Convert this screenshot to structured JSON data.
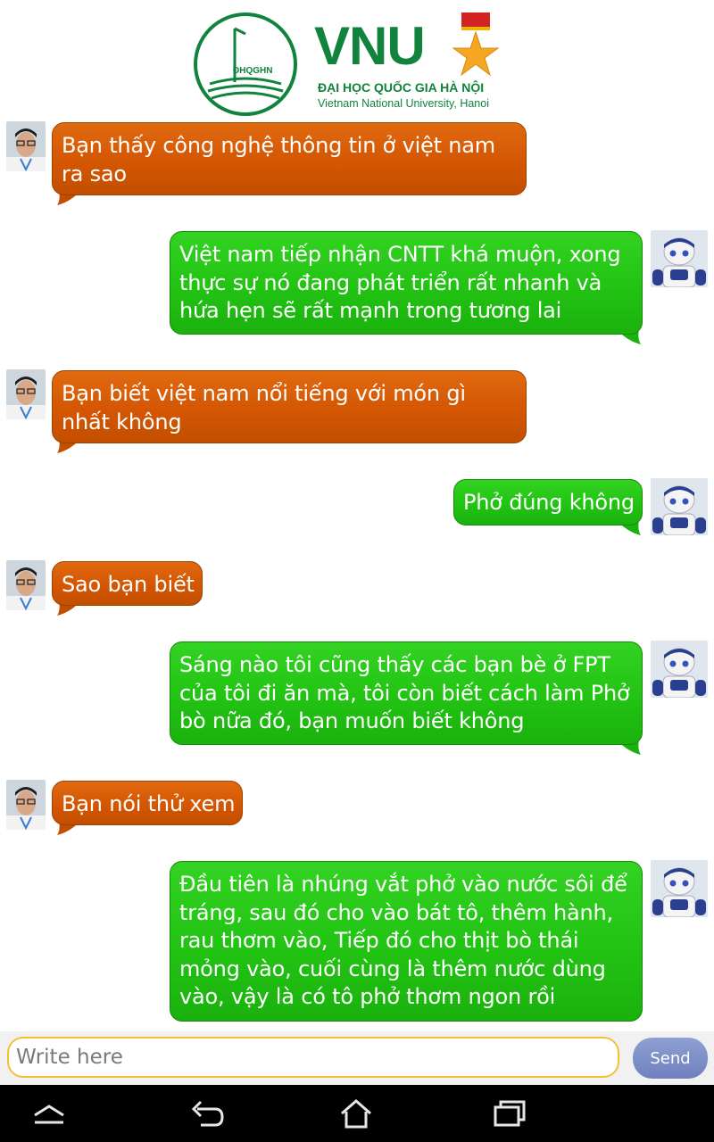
{
  "header": {
    "emblem_text": "ĐHQGHN",
    "brand": "VNU",
    "line1": "ĐẠI HỌC QUỐC GIA HÀ NỘI",
    "line2": "Vietnam National University, Hanoi",
    "brand_color": "#11833c"
  },
  "messages": [
    {
      "sender": "user",
      "text": "Bạn thấy công nghệ thông tin ở việt nam ra sao"
    },
    {
      "sender": "bot",
      "text": "Việt nam tiếp nhận CNTT khá muộn, xong thực sự nó đang phát triển rất nhanh và hứa hẹn sẽ rất mạnh trong tương lai"
    },
    {
      "sender": "user",
      "text": "Bạn biết việt nam nổi tiếng với món gì nhất không"
    },
    {
      "sender": "bot",
      "text": "Phở đúng không"
    },
    {
      "sender": "user",
      "text": "Sao bạn biết"
    },
    {
      "sender": "bot",
      "text": "Sáng nào tôi cũng thấy các bạn bè ở FPT của tôi đi ăn mà, tôi còn biết cách làm Phở bò nữa đó, bạn muốn biết không"
    },
    {
      "sender": "user",
      "text": "Bạn nói thử xem"
    },
    {
      "sender": "bot",
      "text": "Đầu tiên là nhúng vắt phở vào nước sôi để tráng, sau đó cho vào bát tô, thêm hành, rau thơm vào, Tiếp đó cho thịt bò thái mỏng vào, cuối cùng là thêm nước dùng vào, vậy là có tô phở thơm ngon rồi"
    }
  ],
  "colors": {
    "user_bubble": "#d45603",
    "bot_bubble": "#22c313",
    "input_border": "#f1c232",
    "send_button": "#7b8cc8"
  },
  "input": {
    "placeholder": "Write here",
    "value": ""
  },
  "send_label": "Send",
  "navbar": {
    "icons": [
      "expand-icon",
      "back-icon",
      "home-icon",
      "recent-apps-icon"
    ]
  }
}
